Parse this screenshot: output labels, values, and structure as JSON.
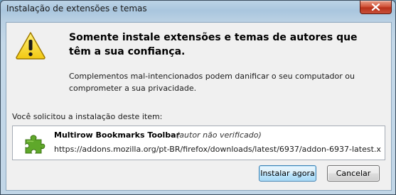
{
  "window": {
    "title": "Instalação de extensões e temas"
  },
  "warning": {
    "heading": "Somente instale extensões e temas de autores que têm a sua confiança.",
    "description": "Complementos mal-intencionados podem danificar o seu computador ou comprometer a sua privacidade."
  },
  "request": {
    "label": "Você solicitou a instalação deste item:",
    "addon": {
      "name": "Multirow Bookmarks Toolbar",
      "status": "(autor não verificado)",
      "url": "https://addons.mozilla.org/pt-BR/firefox/downloads/latest/6937/addon-6937-latest.x"
    }
  },
  "buttons": {
    "install": "Instalar agora",
    "cancel": "Cancelar"
  },
  "icons": {
    "warning": "warning-triangle-icon",
    "addon": "puzzle-piece-icon",
    "close": "close-x-icon"
  },
  "colors": {
    "warning_yellow": "#f2c811",
    "puzzle_green": "#5fa82a",
    "close_red": "#c8402a",
    "default_button_border": "#3c7fb1"
  }
}
